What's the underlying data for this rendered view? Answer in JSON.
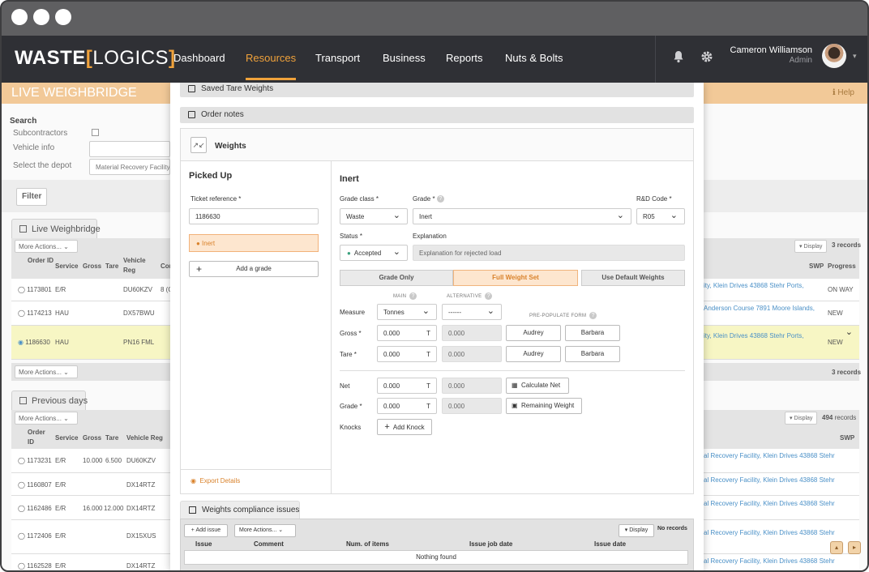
{
  "nav": {
    "logo_waste": "WASTE",
    "logo_bracket_l": "[",
    "logo_logics": "LOGICS",
    "logo_bracket_r": "]",
    "items": [
      "Dashboard",
      "Resources",
      "Transport",
      "Business",
      "Reports",
      "Nuts & Bolts"
    ],
    "active": "Resources",
    "user_name": "Cameron Williamson",
    "user_role": "Admin",
    "accent": "#f0a23b"
  },
  "background": {
    "page_title": "LIVE WEIGHBRIDGE",
    "help": "ℹ Help",
    "search_title": "Search",
    "subcontractors": "Subcontractors",
    "vehicle_info": "Vehicle info",
    "select_depot": "Select the depot",
    "depot_value": "Material Recovery Facility,",
    "filter": "Filter",
    "tab_live": "Live Weighbridge",
    "more_actions": "More Actions...",
    "display": "▾ Display",
    "live_records": "3 records",
    "live_headers": [
      "Order ID",
      "Service",
      "Gross",
      "Tare",
      "Vehicle Reg",
      "Cor",
      "SWP",
      "Progress"
    ],
    "live_rows": [
      {
        "id": "1173801",
        "service": "E/R",
        "reg": "DU60KZV",
        "extra": "8 (O",
        "addr": "ity, Klein Drives 43868 Stehr Ports,",
        "status": "ON WAY"
      },
      {
        "id": "1174213",
        "service": "HAU",
        "reg": "DX57BWU",
        "extra": "",
        "addr": "Anderson Course 7891 Moore Islands,",
        "status": "NEW"
      },
      {
        "id": "1186630",
        "service": "HAU",
        "reg": "PN16 FML",
        "extra": "",
        "addr": "ity, Klein Drives 43868 Stehr Ports,",
        "status": "NEW"
      }
    ],
    "tab_prev": "Previous days",
    "prev_records_count": "494",
    "prev_records_word": "records",
    "prev_headers": [
      "Order ID",
      "Service",
      "Gross",
      "Tare",
      "Vehicle Reg",
      "SWP"
    ],
    "prev_rows": [
      {
        "id": "1173231",
        "service": "E/R",
        "gross": "10.000",
        "tare": "6.500",
        "reg": "DU60KZV",
        "addr": "al Recovery Facility, Klein Drives 43868 Stehr"
      },
      {
        "id": "1160807",
        "service": "E/R",
        "gross": "",
        "tare": "",
        "reg": "DX14RTZ",
        "addr": "al Recovery Facility, Klein Drives 43868 Stehr"
      },
      {
        "id": "1162486",
        "service": "E/R",
        "gross": "16.000",
        "tare": "12.000",
        "reg": "DX14RTZ",
        "addr": "al Recovery Facility, Klein Drives 43868 Stehr"
      },
      {
        "id": "1172406",
        "service": "E/R",
        "gross": "",
        "tare": "",
        "reg": "DX15XUS",
        "addr": "al Recovery Facility, Klein Drives 43868 Stehr"
      },
      {
        "id": "1162528",
        "service": "E/R",
        "gross": "",
        "tare": "",
        "reg": "DX14RTZ",
        "addr": "al Recovery Facility, Klein Drives 43868 Stehr"
      }
    ]
  },
  "modal": {
    "saved_tare": "Saved Tare Weights",
    "order_notes": "Order notes",
    "weights_title": "Weights",
    "picked_up": "Picked Up",
    "ticket_label": "Ticket reference *",
    "ticket_value": "1186630",
    "grade_item": "● Inert",
    "add_grade": "Add a grade",
    "export": "Export Details",
    "section_title": "Inert",
    "grade_class_label": "Grade class *",
    "grade_class_value": "Waste",
    "grade_label": "Grade *",
    "grade_value": "Inert",
    "rd_label": "R&D Code *",
    "rd_value": "R05",
    "status_label": "Status *",
    "status_value": "Accepted",
    "explanation_label": "Explanation",
    "explanation_placeholder": "Explanation for rejected load",
    "seg": [
      "Grade Only",
      "Full Weight Set",
      "Use Default Weights"
    ],
    "seg_active": 1,
    "main_label": "MAIN",
    "alt_label": "ALTERNATIVE",
    "prepopulate": "PRE-POPULATE FORM",
    "measure_label": "Measure",
    "measure_value": "Tonnes",
    "alt_measure_value": "------",
    "gross_label": "Gross *",
    "tare_label": "Tare *",
    "net_label": "Net",
    "grade_w_label": "Grade *",
    "knocks_label": "Knocks",
    "zero": "0.000",
    "unit": "T",
    "audrey": "Audrey",
    "barbara": "Barbara",
    "calc_net": "Calculate Net",
    "remaining": "Remaining Weight",
    "add_knock": "Add Knock",
    "compliance_tab": "Weights compliance issues",
    "add_issue": "+ Add issue",
    "display": "▾ Display",
    "no_records": "No records",
    "issue_headers": [
      "Issue",
      "Comment",
      "Num. of items",
      "Issue job date",
      "Issue date"
    ],
    "nothing_found": "Nothing found"
  }
}
